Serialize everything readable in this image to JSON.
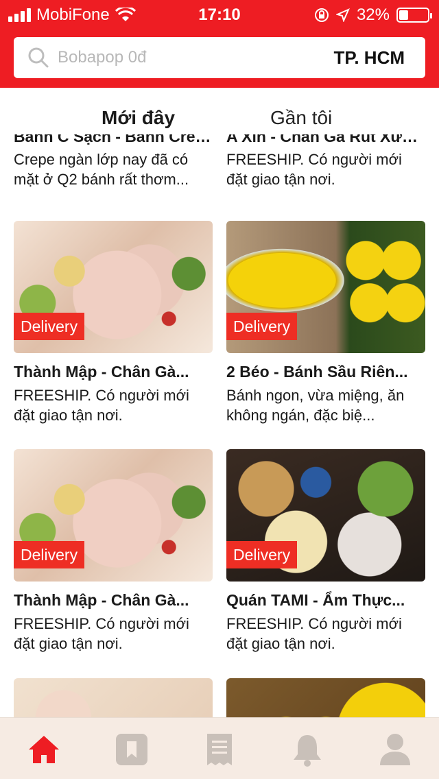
{
  "status_bar": {
    "carrier": "MobiFone",
    "time": "17:10",
    "battery_percent": "32%",
    "battery_level": 0.32
  },
  "search": {
    "placeholder": "Bobapop 0đ",
    "city": "TP. HCM"
  },
  "tabs": [
    {
      "label": "Mới đây",
      "active": true
    },
    {
      "label": "Gần tôi",
      "active": false
    }
  ],
  "partial_row": [
    {
      "title": "Bánh C Sạch - Bánh Crepe",
      "desc": "Crepe ngàn lớp nay đã có mặt ở Q2 bánh rất thơm..."
    },
    {
      "title": "A Xìn - Chân Gà Rút Xương",
      "desc": "FREESHIP. Có người mới đặt giao tận nơi."
    }
  ],
  "cards": [
    {
      "badge": "Delivery",
      "title": "Thành Mập - Chân Gà...",
      "desc": "FREESHIP. Có người mới đặt giao tận nơi."
    },
    {
      "badge": "Delivery",
      "title": "2 Béo - Bánh Sầu Riên...",
      "desc": "Bánh ngon, vừa miệng, ăn không ngán, đặc biệ..."
    },
    {
      "badge": "Delivery",
      "title": "Thành Mập - Chân Gà...",
      "desc": "FREESHIP. Có người mới đặt giao tận nơi."
    },
    {
      "badge": "Delivery",
      "title": "Quán TAMI - Ẩm Thực...",
      "desc": "FREESHIP. Có người mới đặt giao tận nơi."
    }
  ],
  "bottom_nav": [
    {
      "icon": "home-icon",
      "active": true
    },
    {
      "icon": "bookmark-icon",
      "active": false
    },
    {
      "icon": "receipt-icon",
      "active": false
    },
    {
      "icon": "bell-icon",
      "active": false
    },
    {
      "icon": "profile-icon",
      "active": false
    }
  ],
  "colors": {
    "brand_red": "#ee1d23",
    "badge_red": "#ee2e24",
    "nav_inactive": "#c9c0b9"
  }
}
